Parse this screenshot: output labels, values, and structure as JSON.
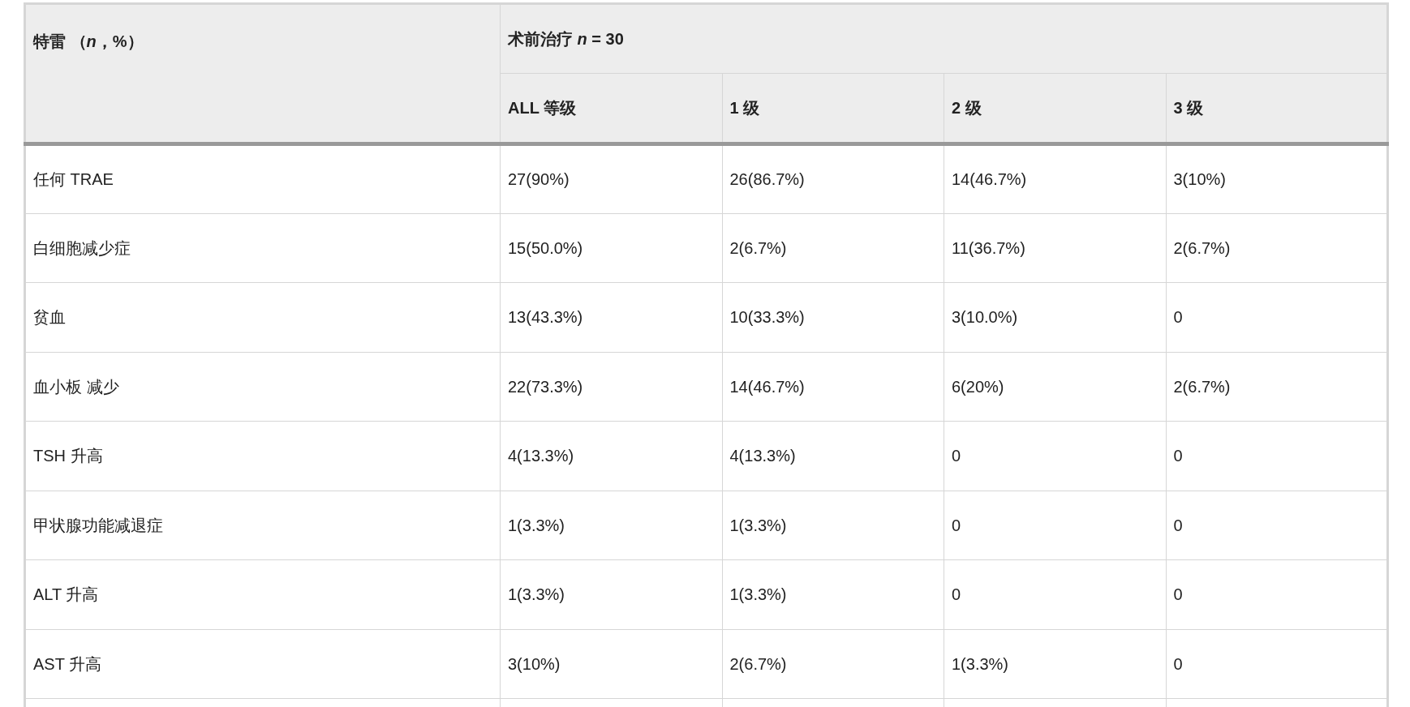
{
  "table": {
    "corner_header": "特雷 （*n*，%）",
    "group_header": "术前治疗 *n* = 30",
    "columns": [
      "ALL 等级",
      "1 级",
      "2 级",
      "3 级"
    ],
    "rows": [
      {
        "label": "任何 TRAE",
        "cells": [
          "27(90%)",
          "26(86.7%)",
          "14(46.7%)",
          "3(10%)"
        ]
      },
      {
        "label": "白细胞减少症",
        "cells": [
          "15(50.0%)",
          "2(6.7%)",
          "11(36.7%)",
          "2(6.7%)"
        ]
      },
      {
        "label": "贫血",
        "cells": [
          "13(43.3%)",
          "10(33.3%)",
          "3(10.0%)",
          "0"
        ]
      },
      {
        "label": "血小板 减少",
        "cells": [
          "22(73.3%)",
          "14(46.7%)",
          "6(20%)",
          "2(6.7%)"
        ]
      },
      {
        "label": "TSH 升高",
        "cells": [
          "4(13.3%)",
          "4(13.3%)",
          "0",
          "0"
        ]
      },
      {
        "label": "甲状腺功能减退症",
        "cells": [
          "1(3.3%)",
          "1(3.3%)",
          "0",
          "0"
        ]
      },
      {
        "label": "ALT 升高",
        "cells": [
          "1(3.3%)",
          "1(3.3%)",
          "0",
          "0"
        ]
      },
      {
        "label": "AST 升高",
        "cells": [
          "3(10%)",
          "2(6.7%)",
          "1(3.3%)",
          "0"
        ]
      }
    ]
  }
}
